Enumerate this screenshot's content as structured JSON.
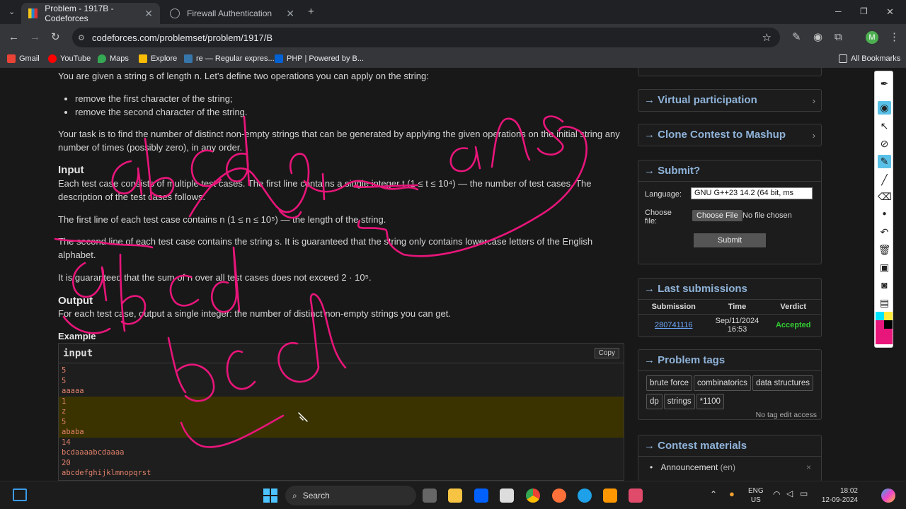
{
  "browser": {
    "tabs": [
      {
        "title": "Problem - 1917B - Codeforces",
        "active": true
      },
      {
        "title": "Firewall Authentication",
        "active": false
      }
    ],
    "url": "codeforces.com/problemset/problem/1917/B",
    "profile_initial": "M",
    "bookmarks": [
      "Gmail",
      "YouTube",
      "Maps",
      "Explore",
      "re — Regular expres...",
      "PHP | Powered by B..."
    ],
    "all_bookmarks": "All Bookmarks"
  },
  "problem": {
    "intro": "You are given a string s of length n. Let's define two operations you can apply on the string:",
    "ops": [
      "remove the first character of the string;",
      "remove the second character of the string."
    ],
    "task": "Your task is to find the number of distinct non-empty strings that can be generated by applying the given operations on the initial string any number of times (possibly zero), in any order.",
    "input_heading": "Input",
    "input_p1": "Each test case consists of multiple test cases. The first line contains a single integer t (1 ≤ t ≤ 10⁴) — the number of test cases. The description of the test cases follows.",
    "input_p2": "The first line of each test case contains n (1 ≤ n ≤ 10⁵) — the length of the string.",
    "input_p3": "The second line of each test case contains the string s. It is guaranteed that the string only contains lowercase letters of the English alphabet.",
    "input_p4": "It is guaranteed that the sum of n over all test cases does not exceed 2 · 10⁵.",
    "output_heading": "Output",
    "output_p": "For each test case, output a single integer: the number of distinct non-empty strings you can get.",
    "example_heading": "Example",
    "example_input_label": "input",
    "copy_label": "Copy",
    "example_lines": [
      {
        "text": "5",
        "hl": false
      },
      {
        "text": "5",
        "hl": false
      },
      {
        "text": "aaaaa",
        "hl": false
      },
      {
        "text": "1",
        "hl": true
      },
      {
        "text": "z",
        "hl": true
      },
      {
        "text": "5",
        "hl": true
      },
      {
        "text": "ababa",
        "hl": true
      },
      {
        "text": "14",
        "hl": false
      },
      {
        "text": "bcdaaaabcdaaaa",
        "hl": false
      },
      {
        "text": "20",
        "hl": false
      },
      {
        "text": "abcdefghijklmnopqrst",
        "hl": false
      }
    ]
  },
  "sidebar": {
    "virtual": "→ Virtual participation",
    "clone": "→ Clone Contest to Mashup",
    "submit_title": "→ Submit?",
    "language_label": "Language:",
    "language_value": "GNU G++23 14.2 (64 bit, ms",
    "choose_file_label": "Choose file:",
    "choose_file_btn": "Choose File",
    "no_file": "No file chosen",
    "submit_btn": "Submit",
    "last_sub_title": "→ Last submissions",
    "sub_headers": [
      "Submission",
      "Time",
      "Verdict"
    ],
    "sub_id": "280741116",
    "sub_time": "Sep/11/2024 16:53",
    "sub_verdict": "Accepted",
    "tags_title": "→ Problem tags",
    "tags": [
      "brute force",
      "combinatorics",
      "data structures",
      "dp",
      "strings",
      "*1100"
    ],
    "no_tag_edit": "No tag edit access",
    "materials_title": "→ Contest materials",
    "announcement": "Announcement",
    "announcement_lang": "(en)"
  },
  "taskbar": {
    "search": "Search",
    "lang_line1": "ENG",
    "lang_line2": "US",
    "time": "18:02",
    "date": "12-09-2024"
  },
  "colors": {
    "ink": "#e8157a",
    "accepted": "#3c3",
    "link": "#8fb3d9"
  }
}
